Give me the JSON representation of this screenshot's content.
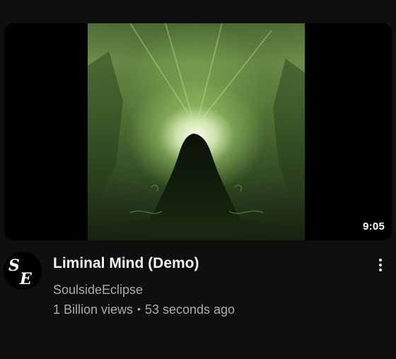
{
  "video": {
    "duration": "9:05",
    "title": "Liminal Mind (Demo)",
    "channel": "SoulsideEclipse",
    "views": "1 Billion views",
    "separator": "•",
    "age": "53 seconds ago"
  },
  "avatar": {
    "initials_top": "S",
    "initials_bottom": "E"
  },
  "icons": {
    "more": "more-vertical-icon"
  },
  "colors": {
    "background": "#0f0f0f",
    "title": "#f1f1f1",
    "secondary": "#aaaaaa",
    "art_green": "#6f8f4a"
  }
}
